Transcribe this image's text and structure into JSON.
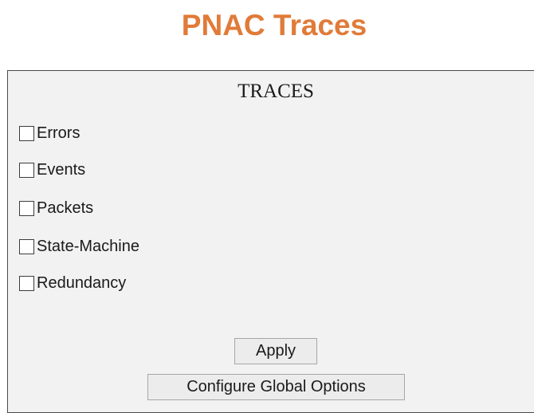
{
  "page": {
    "title": "PNAC Traces"
  },
  "panel": {
    "heading": "TRACES",
    "options": [
      {
        "label": "Errors",
        "checked": false
      },
      {
        "label": "Events",
        "checked": false
      },
      {
        "label": "Packets",
        "checked": false
      },
      {
        "label": "State-Machine",
        "checked": false
      },
      {
        "label": "Redundancy",
        "checked": false
      }
    ]
  },
  "buttons": {
    "apply_label": "Apply",
    "configure_label": "Configure Global Options"
  },
  "colors": {
    "title": "#e07b39",
    "panel_background": "#f2f2f2",
    "panel_border": "#4a4a4a",
    "button_background": "#ececec"
  }
}
